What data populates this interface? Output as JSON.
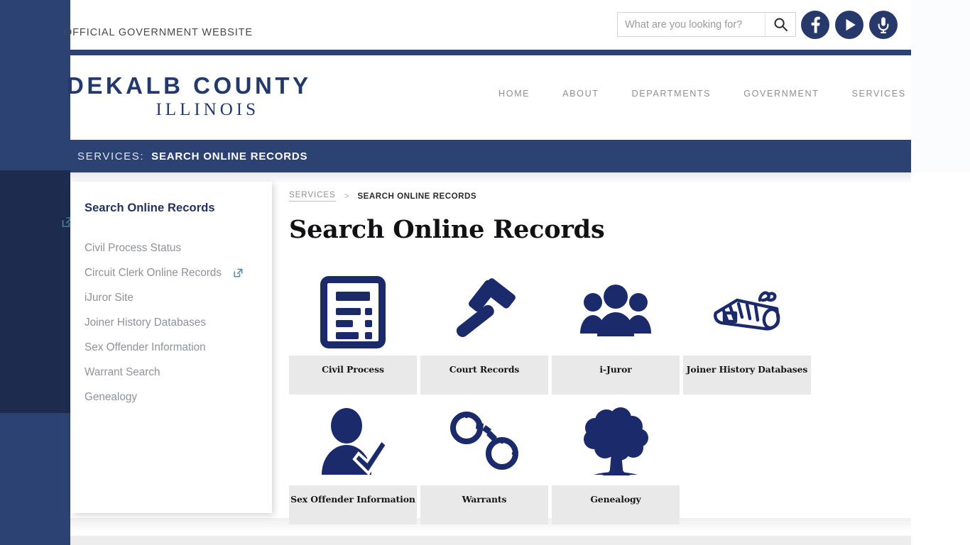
{
  "colors": {
    "navy": "#2c4272",
    "navy_dark": "#1d2b4f",
    "brand_blue": "#23396b",
    "icon_navy": "#1b2a6b",
    "tile_label_bg": "#e9e9e9",
    "ext_link_blue": "#4b7fa4",
    "muted_text": "#8e9299"
  },
  "utility_bar": {
    "official_notice": "OFFICIAL GOVERNMENT WEBSITE",
    "search": {
      "placeholder": "What are you looking for?",
      "value": "",
      "button_icon": "search-icon"
    },
    "socials": [
      {
        "name": "facebook-icon",
        "label": "Facebook"
      },
      {
        "name": "youtube-play-icon",
        "label": "YouTube"
      },
      {
        "name": "microphone-icon",
        "label": "Podcast"
      }
    ]
  },
  "masthead": {
    "brand_line1": "DEKALB COUNTY",
    "brand_line2": "ILLINOIS",
    "nav": [
      {
        "label": "HOME"
      },
      {
        "label": "ABOUT"
      },
      {
        "label": "DEPARTMENTS"
      },
      {
        "label": "GOVERNMENT"
      },
      {
        "label": "SERVICES"
      }
    ]
  },
  "banner": {
    "kicker": "SERVICES:",
    "title": "SEARCH ONLINE RECORDS"
  },
  "sidebar": {
    "heading": "Search Online Records",
    "items": [
      {
        "label": "Civil Process Status",
        "external": false
      },
      {
        "label": "Circuit Clerk Online Records",
        "external": true
      },
      {
        "label": "iJuror Site",
        "external": false
      },
      {
        "label": "Joiner History Databases",
        "external": false
      },
      {
        "label": "Sex Offender Information",
        "external": false
      },
      {
        "label": "Warrant Search",
        "external": false
      },
      {
        "label": "Genealogy",
        "external": false
      }
    ]
  },
  "breadcrumb": {
    "parent": "SERVICES",
    "separator": ">",
    "current": "SEARCH ONLINE RECORDS"
  },
  "main": {
    "page_title": "Search Online Records",
    "tiles": [
      {
        "label": "Civil Process",
        "icon": "document-form-icon"
      },
      {
        "label": "Court Records",
        "icon": "gavel-icon"
      },
      {
        "label": "i-Juror",
        "icon": "people-group-icon"
      },
      {
        "label": "Joiner History Databases",
        "icon": "rolled-newspaper-icon"
      },
      {
        "label": "Sex Offender Information",
        "icon": "person-check-icon"
      },
      {
        "label": "Warrants",
        "icon": "handcuffs-icon"
      },
      {
        "label": "Genealogy",
        "icon": "tree-icon"
      }
    ]
  },
  "left_rail": {
    "external_link_icon": "external-link-icon"
  }
}
